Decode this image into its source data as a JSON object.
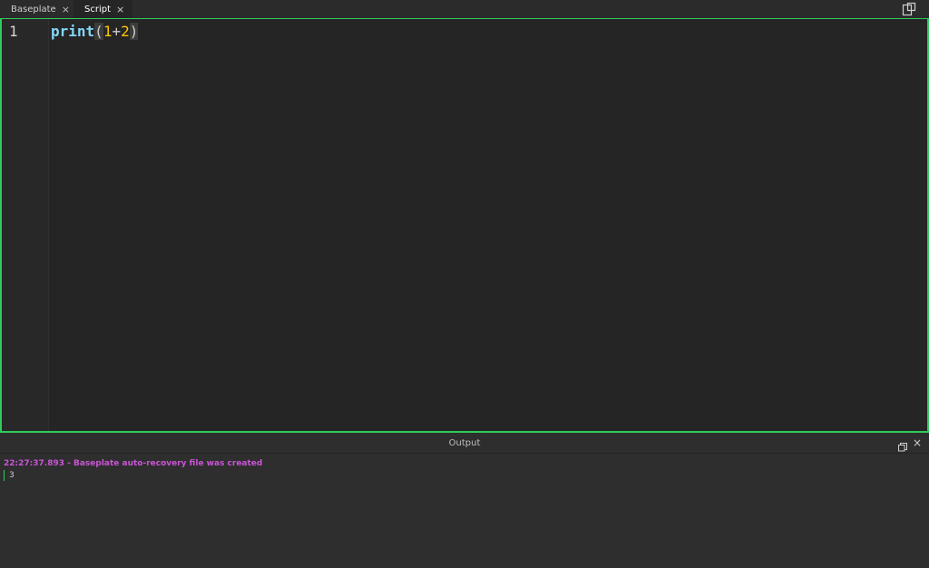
{
  "tabs": [
    {
      "label": "Baseplate",
      "close": "×"
    },
    {
      "label": "Script",
      "close": "×"
    }
  ],
  "editor": {
    "line_number": "1",
    "code": {
      "func": "print",
      "open_paren": "(",
      "a": "1",
      "op": "+",
      "b": "2",
      "close_paren": ")"
    }
  },
  "output": {
    "title": "Output",
    "close": "×",
    "log": [
      {
        "text": "22:27:37.893 - Baseplate auto-recovery file was created",
        "kind": "info"
      },
      {
        "text": "3",
        "kind": "print"
      }
    ]
  },
  "colors": {
    "accent": "#2ecc5a",
    "builtin": "#84d6f7",
    "number": "#ffc600",
    "info_log": "#c955d6"
  },
  "icons": {
    "dock": "dock-window-icon",
    "restore": "restore-window-icon",
    "close": "close-icon"
  }
}
